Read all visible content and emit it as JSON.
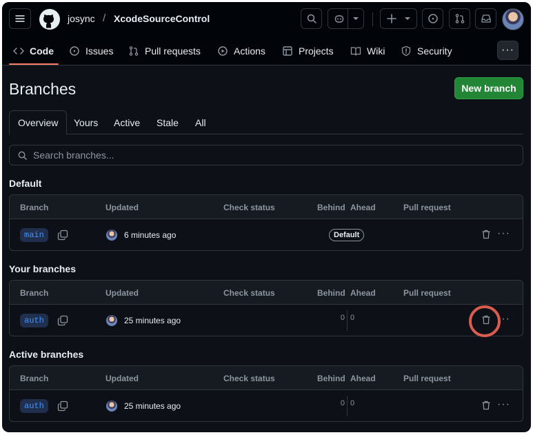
{
  "header": {
    "owner": "josync",
    "separator": "/",
    "repo": "XcodeSourceControl"
  },
  "nav": {
    "code": "Code",
    "issues": "Issues",
    "pull_requests": "Pull requests",
    "actions": "Actions",
    "projects": "Projects",
    "wiki": "Wiki",
    "security": "Security",
    "more": "···"
  },
  "page": {
    "title": "Branches",
    "new_branch": "New branch"
  },
  "tabs": [
    "Overview",
    "Yours",
    "Active",
    "Stale",
    "All"
  ],
  "search": {
    "placeholder": "Search branches..."
  },
  "columns": {
    "branch": "Branch",
    "updated": "Updated",
    "check_status": "Check status",
    "behind": "Behind",
    "ahead": "Ahead",
    "pull_request": "Pull request"
  },
  "sections": {
    "default": {
      "title": "Default",
      "row": {
        "branch": "main",
        "updated": "6 minutes ago",
        "badge": "Default"
      }
    },
    "yours": {
      "title": "Your branches",
      "row": {
        "branch": "auth",
        "updated": "25 minutes ago",
        "behind": "0",
        "ahead": "0"
      }
    },
    "active": {
      "title": "Active branches",
      "row": {
        "branch": "auth",
        "updated": "25 minutes ago",
        "behind": "0",
        "ahead": "0"
      }
    }
  },
  "row_menu": "···",
  "colors": {
    "accent_green": "#238636",
    "link_blue": "#4493f8",
    "highlight_ring": "#d95c4e"
  }
}
